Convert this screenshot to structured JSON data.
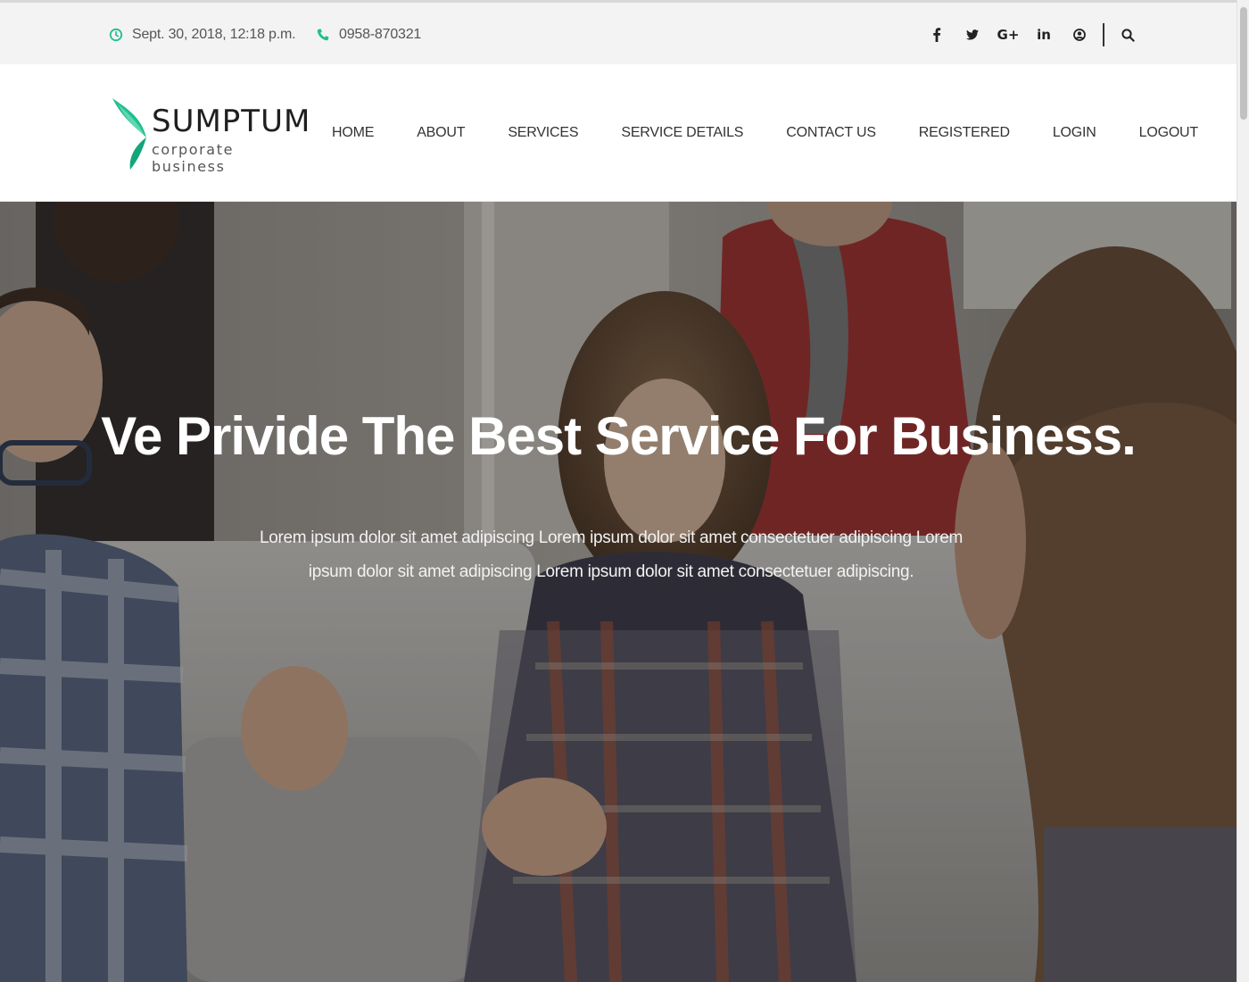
{
  "topbar": {
    "datetime": "Sept. 30, 2018, 12:18 p.m.",
    "datetime_icon": "clock-icon",
    "phone": "0958-870321",
    "phone_icon": "phone-icon",
    "socials": [
      {
        "icon": "facebook-icon",
        "glyph": "f"
      },
      {
        "icon": "twitter-icon",
        "glyph": "t"
      },
      {
        "icon": "google-plus-icon",
        "glyph": "G+"
      },
      {
        "icon": "linkedin-icon",
        "glyph": "in"
      },
      {
        "icon": "user-icon",
        "glyph": ""
      }
    ],
    "search_icon": "search-icon"
  },
  "logo": {
    "title": "SUMPTUM",
    "subtitle": "corporate business"
  },
  "nav": {
    "items": [
      "HOME",
      "ABOUT",
      "SERVICES",
      "SERVICE DETAILS",
      "CONTACT US",
      "REGISTERED",
      "LOGIN",
      "LOGOUT"
    ]
  },
  "hero": {
    "title": "Ve Privide The Best Service For Business.",
    "text": "Lorem ipsum dolor sit amet adipiscing Lorem ipsum dolor sit amet consectetuer adipiscing Lorem ipsum dolor sit amet adipiscing Lorem ipsum dolor sit amet consectetuer adipiscing."
  },
  "colors": {
    "accent": "#1fbf8f",
    "topbar_bg": "#f3f3f3",
    "hero_overlay": "#141414"
  }
}
